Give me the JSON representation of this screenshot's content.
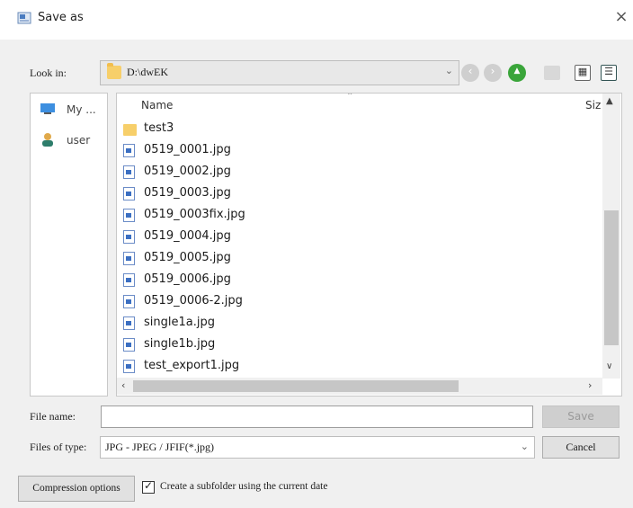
{
  "window": {
    "title": "Save as",
    "close_glyph": "×"
  },
  "look_in": {
    "label": "Look in:",
    "path": "D:\\dwEK"
  },
  "toolbar": {
    "back_icon": "back-arrow-icon",
    "forward_icon": "forward-arrow-icon",
    "up_icon": "up-folder-icon",
    "new_folder_icon": "new-folder-icon",
    "list_view_icon": "list-view-icon",
    "details_view_icon": "details-view-icon"
  },
  "places": [
    {
      "label": "My ...",
      "icon": "computer-icon"
    },
    {
      "label": "user",
      "icon": "user-icon"
    }
  ],
  "file_list": {
    "columns": {
      "name": "Name",
      "size": "Siz"
    },
    "items": [
      {
        "name": "test3",
        "type": "folder"
      },
      {
        "name": "0519_0001.jpg",
        "type": "file"
      },
      {
        "name": "0519_0002.jpg",
        "type": "file"
      },
      {
        "name": "0519_0003.jpg",
        "type": "file"
      },
      {
        "name": "0519_0003fix.jpg",
        "type": "file"
      },
      {
        "name": "0519_0004.jpg",
        "type": "file"
      },
      {
        "name": "0519_0005.jpg",
        "type": "file"
      },
      {
        "name": "0519_0006.jpg",
        "type": "file"
      },
      {
        "name": "0519_0006-2.jpg",
        "type": "file"
      },
      {
        "name": "single1a.jpg",
        "type": "file"
      },
      {
        "name": "single1b.jpg",
        "type": "file"
      },
      {
        "name": "test_export1.jpg",
        "type": "file"
      }
    ]
  },
  "file_name": {
    "label": "File name:",
    "value": ""
  },
  "file_type": {
    "label": "Files of type:",
    "value": "JPG - JPEG / JFIF(*.jpg)"
  },
  "buttons": {
    "save": "Save",
    "cancel": "Cancel",
    "compression": "Compression options"
  },
  "subfolder_option": {
    "label": "Create a subfolder using the current date",
    "checked": true
  },
  "colors": {
    "dialog_bg": "#f0f0f0",
    "up_arrow": "#3aa53a",
    "folder": "#f7cf6a",
    "file_icon": "#3b6fc2"
  }
}
